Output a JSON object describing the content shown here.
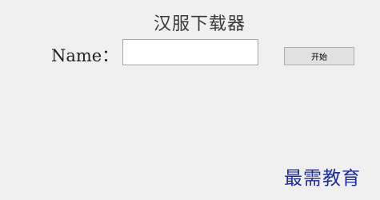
{
  "window": {
    "title": "汉服下载器"
  },
  "form": {
    "name_label": "Name：",
    "name_value": "",
    "start_button_label": "开始"
  },
  "watermark": {
    "text": "最需教育"
  }
}
